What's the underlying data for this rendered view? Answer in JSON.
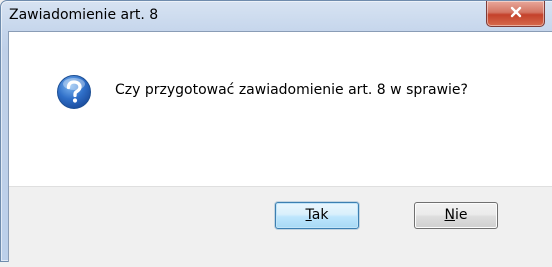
{
  "window": {
    "title": "Zawiadomienie art. 8"
  },
  "dialog": {
    "message": "Czy przygotować zawiadomienie art. 8 w sprawie?",
    "icon": "question-icon"
  },
  "buttons": {
    "yes": {
      "mnemonic": "T",
      "rest": "ak"
    },
    "no": {
      "mnemonic": "N",
      "rest": "ie"
    }
  },
  "colors": {
    "accent": "#3c7fb1",
    "close_button": "#c4422b",
    "frame": "#bcd0ea",
    "button_area": "#f0f0f0",
    "content": "#ffffff"
  }
}
